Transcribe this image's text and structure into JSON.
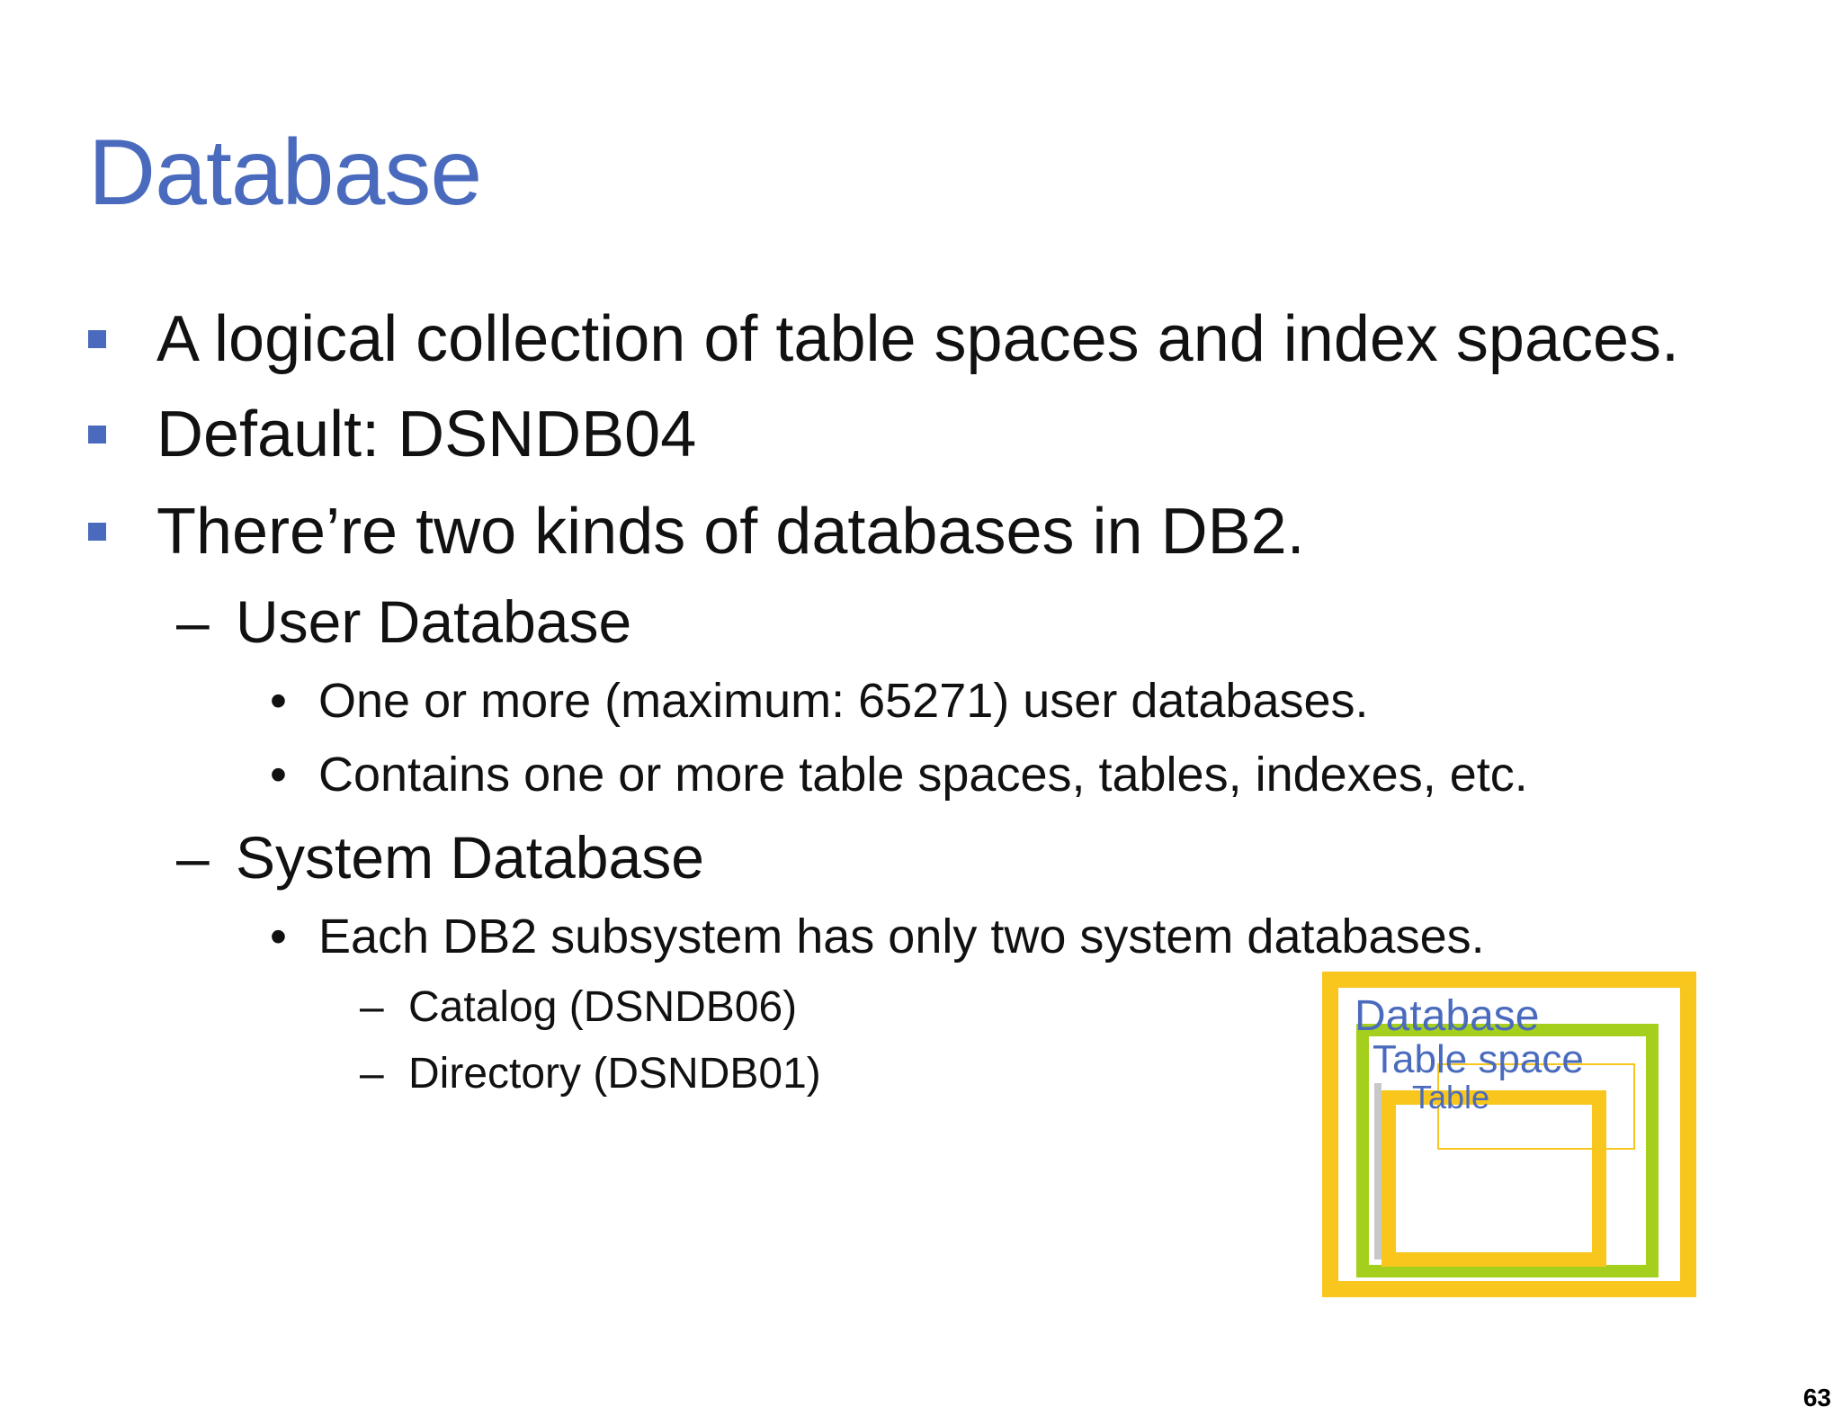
{
  "title": "Database",
  "bullets": [
    "A logical collection of table spaces and index spaces.",
    "Default: DSNDB04",
    "There’re two kinds of databases in DB2."
  ],
  "user_db": {
    "heading": "User Database",
    "points": [
      "One or more (maximum: 65271) user databases.",
      "Contains one or more table spaces, tables, indexes, etc."
    ]
  },
  "system_db": {
    "heading": "System Database",
    "points": [
      "Each DB2 subsystem has only two system databases."
    ],
    "subpoints": [
      "Catalog (DSNDB06)",
      "Directory (DSNDB01)"
    ]
  },
  "diagram": {
    "database_label": "Database",
    "tablespace_label": "Table space",
    "table_label": "Table",
    "colors": {
      "database": "#f8c61d",
      "tablespace": "#a5cf1d",
      "table": "#f8c61d",
      "label": "#4a6bbd"
    }
  },
  "page_number": "63",
  "colors": {
    "title": "#4a6bbd",
    "bullet_marker": "#4a6bbd",
    "text": "#111111"
  },
  "markers": {
    "level2": "–",
    "level3": "•",
    "level4": "–"
  }
}
